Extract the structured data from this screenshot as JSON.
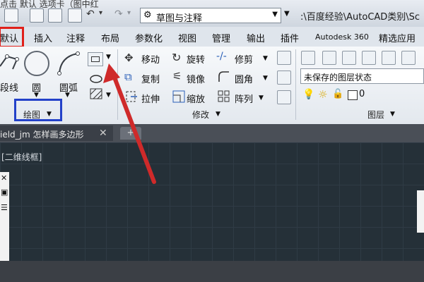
{
  "titlebar": {
    "partial_text": "点击 默认 选项卡（图中红",
    "workspace": "草图与注释",
    "path": ":\\百度经验\\AutoCAD类别\\Sc"
  },
  "menu": {
    "tabs": [
      "默认",
      "插入",
      "注释",
      "布局",
      "参数化",
      "视图",
      "管理",
      "输出",
      "插件",
      "Autodesk 360",
      "精选应用"
    ]
  },
  "ribbon": {
    "draw": {
      "polyline": "段线",
      "circle": "圆",
      "arc": "圆弧",
      "panel_title": "绘图"
    },
    "modify": {
      "move": "移动",
      "rotate": "旋转",
      "trim": "修剪",
      "copy": "复制",
      "mirror": "镜像",
      "fillet": "圆角",
      "stretch": "拉伸",
      "scale": "缩放",
      "array": "阵列",
      "panel_title": "修改"
    },
    "layers": {
      "state": "未保存的图层状态",
      "color_value": "0",
      "panel_title": "图层"
    }
  },
  "document": {
    "tab_title": "ield_jm 怎样画多边形",
    "viewport_label": "[二维线框]"
  },
  "colors": {
    "annotation_red": "#e0201a",
    "annotation_blue": "#2341c9",
    "arrow": "#cf2a2a"
  }
}
